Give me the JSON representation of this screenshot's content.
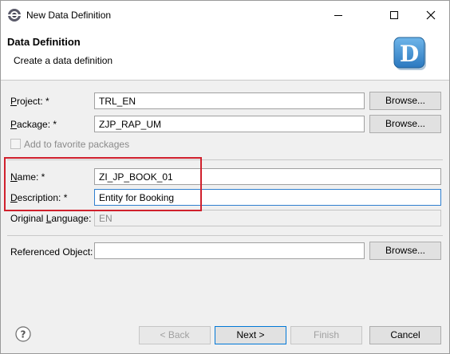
{
  "window": {
    "title": "New Data Definition"
  },
  "header": {
    "title": "Data Definition",
    "subtitle": "Create a data definition"
  },
  "form": {
    "project": {
      "label_key": "P",
      "label_rest": "roject: *",
      "value": "TRL_EN",
      "browse": "Browse..."
    },
    "package": {
      "label_key": "P",
      "label_rest": "ackage: *",
      "value": "ZJP_RAP_UM",
      "browse": "Browse..."
    },
    "favorite": {
      "label": "Add to favorite packages",
      "checked": false
    },
    "name": {
      "label_key": "N",
      "label_rest": "ame: *",
      "value": "ZI_JP_BOOK_01"
    },
    "description": {
      "label_key": "D",
      "label_rest": "escription: *",
      "value": "Entity for Booking"
    },
    "original_language": {
      "label_pre": "Original ",
      "label_key": "L",
      "label_rest": "anguage:",
      "value": "EN"
    },
    "referenced_object": {
      "label": "Referenced Object:",
      "value": "",
      "browse": "Browse..."
    }
  },
  "footer": {
    "back": "< Back",
    "next": "Next >",
    "finish": "Finish",
    "cancel": "Cancel"
  },
  "colors": {
    "highlight": "#d0202c",
    "focus": "#2f7fcf",
    "logo": "#3a8fd0"
  }
}
